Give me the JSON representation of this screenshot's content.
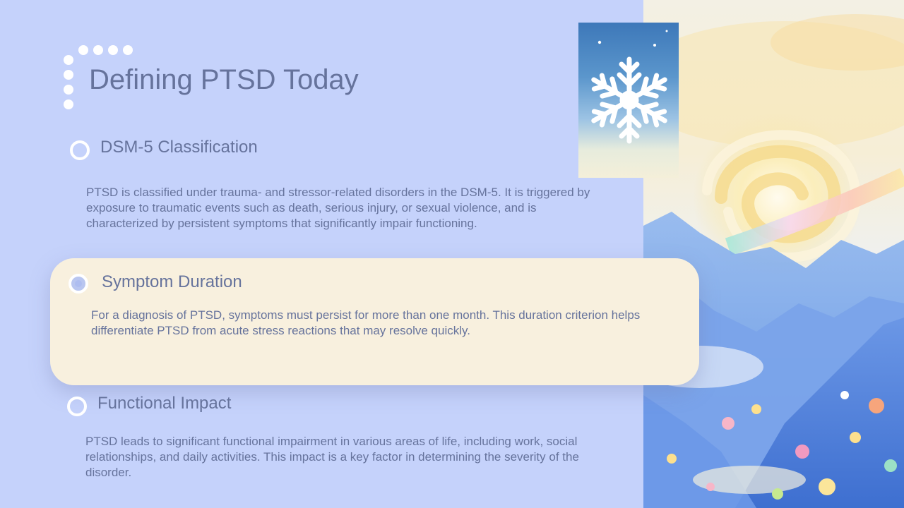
{
  "slide": {
    "title": "Defining PTSD Today"
  },
  "sections": [
    {
      "title": "DSM-5 Classification",
      "body": "PTSD is classified under trauma- and stressor-related disorders in the DSM-5. It is triggered by exposure to traumatic events such as death, serious injury, or sexual violence, and is characterized by persistent symptoms that significantly impair functioning.",
      "highlighted": false
    },
    {
      "title": "Symptom Duration",
      "body": "For a diagnosis of PTSD, symptoms must persist for more than one month. This duration criterion helps differentiate PTSD from acute stress reactions that may resolve quickly.",
      "highlighted": true
    },
    {
      "title": "Functional Impact",
      "body": "PTSD leads to significant functional impairment in various areas of life, including work, social relationships, and daily activities. This impact is a key factor in determining the severity of the disorder.",
      "highlighted": false
    }
  ],
  "images": {
    "snowflake": "snowflake-icon",
    "landscape": "painted-swirl-mountains"
  },
  "colors": {
    "background": "#c5d2fb",
    "highlight_card": "#f8f0de",
    "text": "#66739c",
    "accent_white": "#ffffff"
  }
}
